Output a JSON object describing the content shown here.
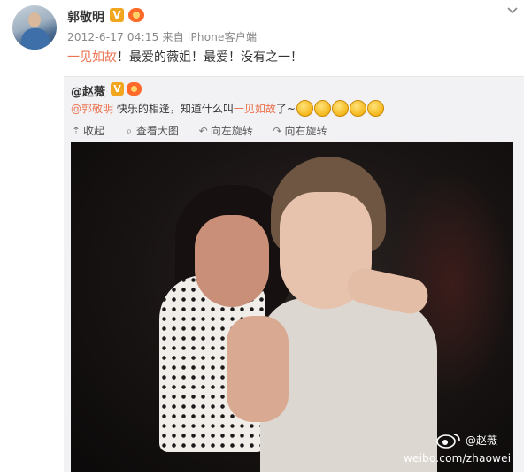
{
  "post": {
    "user": "郭敬明",
    "verified_badge": "V",
    "meta": "2012-6-17 04:15 来自 iPhone客户端",
    "text_prefix": "一见如故",
    "text_rest": "！最爱的薇姐！最爱！没有之一！"
  },
  "repost": {
    "user": "@赵薇",
    "verified_badge": "V",
    "mention": "@郭敬明",
    "text_mid": " 快乐的相逢，知道什么叫",
    "text_highlight": "一见如故",
    "text_end": "了~",
    "emoji_count": 5,
    "actions": [
      {
        "icon": "⇡",
        "icon_name": "collapse-icon",
        "label": "收起"
      },
      {
        "icon": "⌕",
        "icon_name": "zoom-icon",
        "label": "查看大图"
      },
      {
        "icon": "↶",
        "icon_name": "rotate-left-icon",
        "label": "向左旋转"
      },
      {
        "icon": "↷",
        "icon_name": "rotate-right-icon",
        "label": "向右旋转"
      }
    ]
  },
  "watermark": {
    "user": "@赵薇",
    "url": "weibo.com/zhaowei"
  },
  "colors": {
    "accent": "#eb7350",
    "verified": "#f2a51e",
    "repost_bg": "#f2f2f5"
  }
}
